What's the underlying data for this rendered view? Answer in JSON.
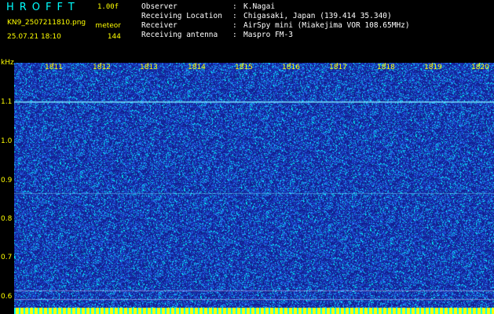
{
  "app": {
    "title": "HROFFT",
    "version": "1.00f",
    "filename": "KN9_2507211810.png",
    "mode": "meteor",
    "datetime": "25.07.21 18:10",
    "count": "144"
  },
  "info": [
    {
      "key": "Observer",
      "value": "K.Nagai"
    },
    {
      "key": "Receiving Location",
      "value": "Chigasaki, Japan (139.414 35.340)"
    },
    {
      "key": "Receiver",
      "value": "AirSpy mini (Miakejima VOR 108.65MHz)"
    },
    {
      "key": "Receiving antenna",
      "value": "Maspro FM-3"
    }
  ],
  "axis": {
    "y_unit": "kHz",
    "y_ticks": [
      "1.1",
      "1.0",
      "0.9",
      "0.8",
      "0.7",
      "0.6"
    ],
    "x_ticks": [
      "1811",
      "1812",
      "1813",
      "1814",
      "1815",
      "1816",
      "1817",
      "1818",
      "1819",
      "1820"
    ]
  },
  "colors": {
    "background": "#1a2fb0",
    "noise_light": "#00ffff",
    "noise_mid": "#3a6bff",
    "label": "#ffff00"
  }
}
